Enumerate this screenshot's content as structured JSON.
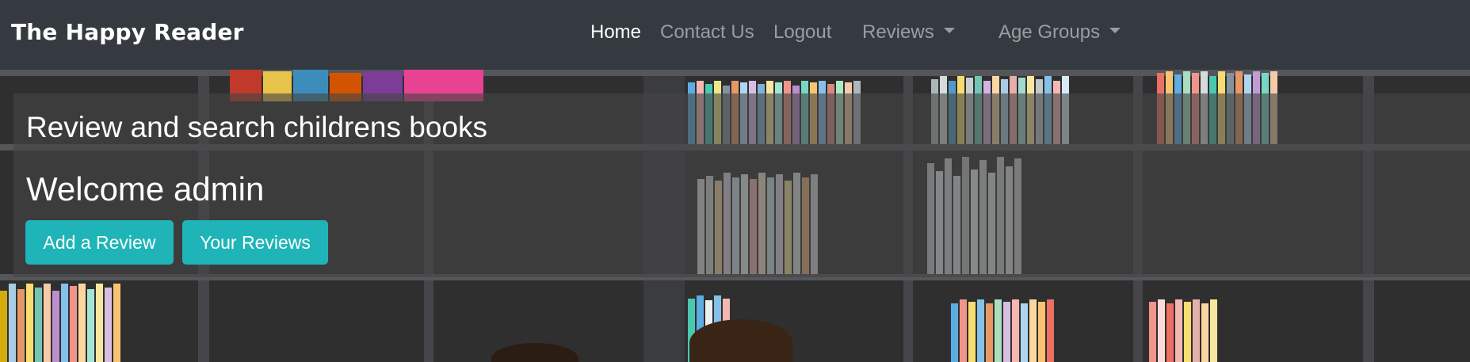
{
  "navbar": {
    "brand": "The Happy Reader",
    "links": [
      {
        "label": "Home",
        "active": true
      },
      {
        "label": "Contact Us",
        "active": false
      },
      {
        "label": "Logout",
        "active": false
      }
    ],
    "dropdowns": [
      {
        "label": "Reviews"
      },
      {
        "label": "Age Groups"
      }
    ]
  },
  "hero": {
    "lead": "Review and search childrens books",
    "welcome": "Welcome admin",
    "buttons": {
      "add_review": "Add a Review",
      "your_reviews": "Your Reviews"
    }
  },
  "colors": {
    "navbar_bg": "#343a40",
    "button_accent": "#1fb5b8",
    "nav_active": "#ffffff",
    "nav_inactive": "#9a9da1"
  }
}
